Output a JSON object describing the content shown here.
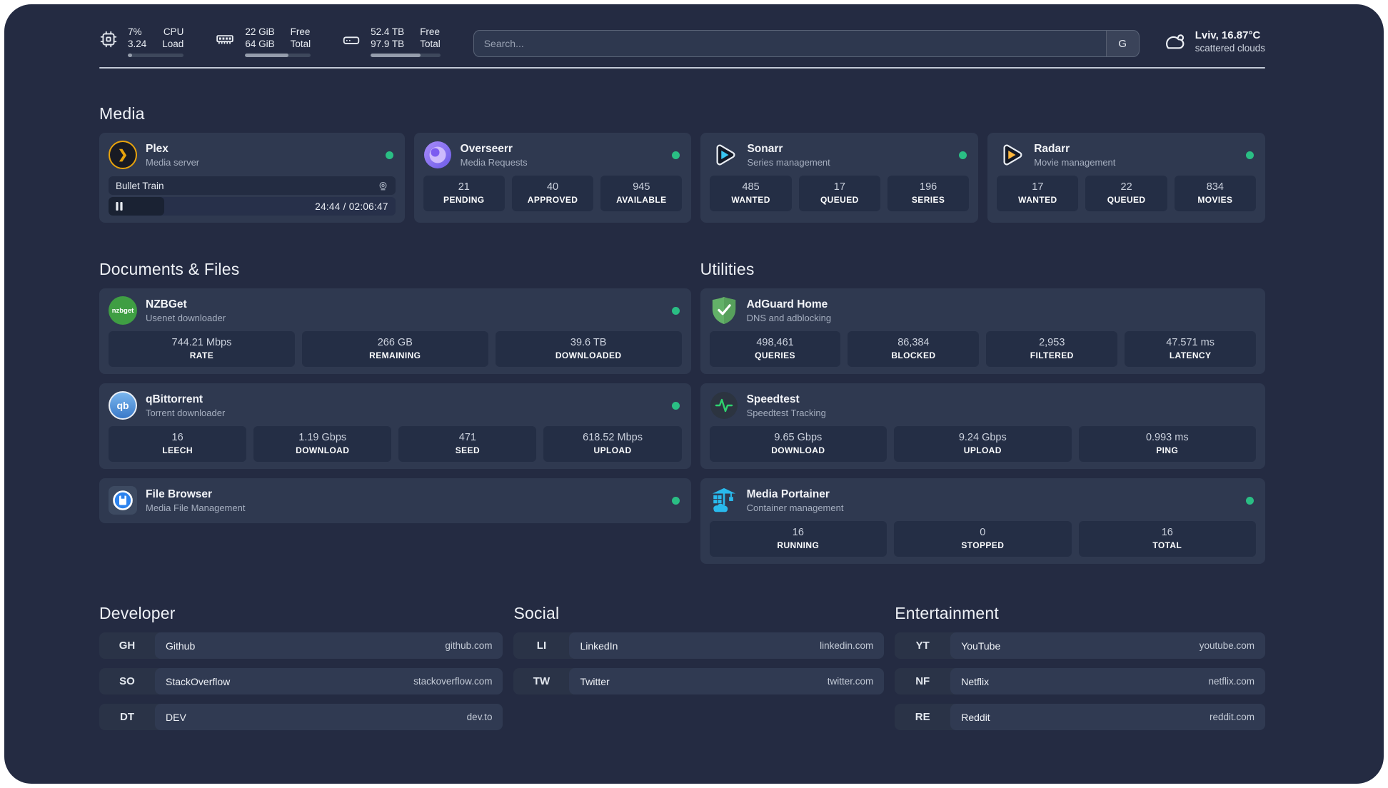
{
  "colors": {
    "background": "#242b42",
    "card": "#2f3950",
    "stat_box": "#242e45",
    "status_online": "#2abe84",
    "plex_brand": "#e8a30c",
    "sonarr_brand": "#38c5f1",
    "radarr_brand": "#fdb53a",
    "adguard_brand": "#63b168",
    "portainer_brand": "#29b9ec",
    "speedtest_pulse": "#2fd36f"
  },
  "header": {
    "metrics": [
      {
        "icon": "cpu-icon",
        "values": [
          "7%",
          "3.24"
        ],
        "labels": [
          "CPU",
          "Load"
        ],
        "progress_style": "width:8%"
      },
      {
        "icon": "memory-icon",
        "values": [
          "22 GiB",
          "64 GiB"
        ],
        "labels": [
          "Free",
          "Total"
        ],
        "progress_style": "width:66%"
      },
      {
        "icon": "disk-icon",
        "values": [
          "52.4 TB",
          "97.9 TB"
        ],
        "labels": [
          "Free",
          "Total"
        ],
        "progress_style": "width:72%"
      }
    ],
    "search": {
      "placeholder": "Search...",
      "engine": "G"
    },
    "weather": {
      "location": "Lviv, 16.87°C",
      "condition": "scattered clouds"
    }
  },
  "sections": {
    "media": {
      "title": "Media",
      "plex": {
        "name": "Plex",
        "subtitle": "Media server",
        "now_playing": {
          "title": "Bullet Train",
          "time": "24:44 / 02:06:47",
          "progress_style": "width:19.5%"
        }
      },
      "overseerr": {
        "name": "Overseerr",
        "subtitle": "Media Requests",
        "stats": [
          {
            "value": "21",
            "label": "PENDING"
          },
          {
            "value": "40",
            "label": "APPROVED"
          },
          {
            "value": "945",
            "label": "AVAILABLE"
          }
        ]
      },
      "sonarr": {
        "name": "Sonarr",
        "subtitle": "Series management",
        "stats": [
          {
            "value": "485",
            "label": "WANTED"
          },
          {
            "value": "17",
            "label": "QUEUED"
          },
          {
            "value": "196",
            "label": "SERIES"
          }
        ]
      },
      "radarr": {
        "name": "Radarr",
        "subtitle": "Movie management",
        "stats": [
          {
            "value": "17",
            "label": "WANTED"
          },
          {
            "value": "22",
            "label": "QUEUED"
          },
          {
            "value": "834",
            "label": "MOVIES"
          }
        ]
      }
    },
    "documents": {
      "title": "Documents & Files",
      "nzbget": {
        "name": "NZBGet",
        "subtitle": "Usenet downloader",
        "stats": [
          {
            "value": "744.21 Mbps",
            "label": "RATE"
          },
          {
            "value": "266 GB",
            "label": "REMAINING"
          },
          {
            "value": "39.6 TB",
            "label": "DOWNLOADED"
          }
        ]
      },
      "qbittorrent": {
        "name": "qBittorrent",
        "subtitle": "Torrent downloader",
        "stats": [
          {
            "value": "16",
            "label": "LEECH"
          },
          {
            "value": "1.19 Gbps",
            "label": "DOWNLOAD"
          },
          {
            "value": "471",
            "label": "SEED"
          },
          {
            "value": "618.52 Mbps",
            "label": "UPLOAD"
          }
        ]
      },
      "filebrowser": {
        "name": "File Browser",
        "subtitle": "Media File Management"
      }
    },
    "utilities": {
      "title": "Utilities",
      "adguard": {
        "name": "AdGuard Home",
        "subtitle": "DNS and adblocking",
        "stats": [
          {
            "value": "498,461",
            "label": "QUERIES"
          },
          {
            "value": "86,384",
            "label": "BLOCKED"
          },
          {
            "value": "2,953",
            "label": "FILTERED"
          },
          {
            "value": "47.571 ms",
            "label": "LATENCY"
          }
        ]
      },
      "speedtest": {
        "name": "Speedtest",
        "subtitle": "Speedtest Tracking",
        "stats": [
          {
            "value": "9.65 Gbps",
            "label": "DOWNLOAD"
          },
          {
            "value": "9.24 Gbps",
            "label": "UPLOAD"
          },
          {
            "value": "0.993 ms",
            "label": "PING"
          }
        ]
      },
      "portainer": {
        "name": "Media Portainer",
        "subtitle": "Container management",
        "stats": [
          {
            "value": "16",
            "label": "RUNNING"
          },
          {
            "value": "0",
            "label": "STOPPED"
          },
          {
            "value": "16",
            "label": "TOTAL"
          }
        ]
      }
    },
    "bookmarks": {
      "developer": {
        "title": "Developer",
        "links": [
          {
            "abbr": "GH",
            "name": "Github",
            "url": "github.com"
          },
          {
            "abbr": "SO",
            "name": "StackOverflow",
            "url": "stackoverflow.com"
          },
          {
            "abbr": "DT",
            "name": "DEV",
            "url": "dev.to"
          }
        ]
      },
      "social": {
        "title": "Social",
        "links": [
          {
            "abbr": "LI",
            "name": "LinkedIn",
            "url": "linkedin.com"
          },
          {
            "abbr": "TW",
            "name": "Twitter",
            "url": "twitter.com"
          }
        ]
      },
      "entertainment": {
        "title": "Entertainment",
        "links": [
          {
            "abbr": "YT",
            "name": "YouTube",
            "url": "youtube.com"
          },
          {
            "abbr": "NF",
            "name": "Netflix",
            "url": "netflix.com"
          },
          {
            "abbr": "RE",
            "name": "Reddit",
            "url": "reddit.com"
          }
        ]
      }
    }
  },
  "logo_labels": {
    "nzbget": "nzbget",
    "qbittorrent": "qb",
    "plex_chevron": "❯"
  }
}
